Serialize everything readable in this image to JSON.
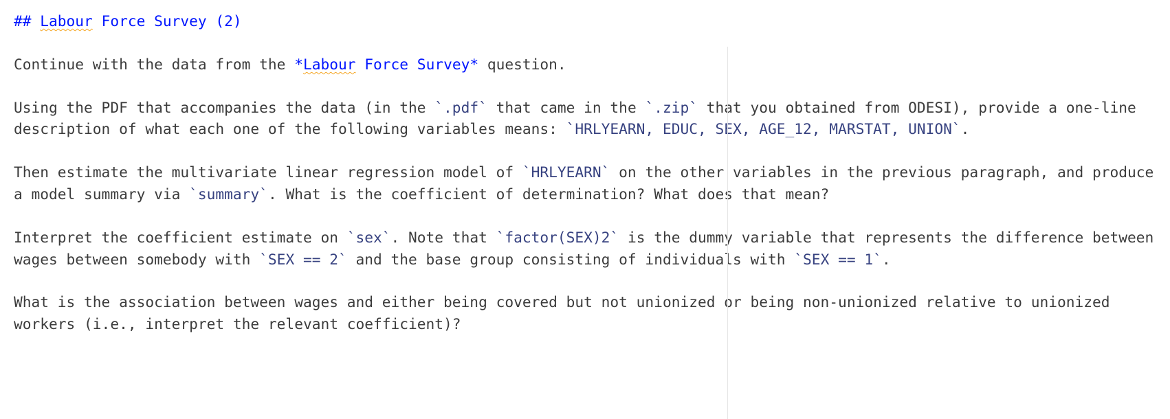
{
  "heading": {
    "prefix": "## ",
    "text": "Labour",
    "rest": " Force Survey (2)"
  },
  "p1": {
    "a": "Continue with the data from the ",
    "link_star1": "*",
    "link_word": "Labour",
    "link_rest": " Force Survey*",
    "b": " question."
  },
  "p2": {
    "a": "Using the PDF that accompanies the data (in the ",
    "c1": "`.pdf`",
    "b": " that came in the ",
    "c2": "`.zip`",
    "c": " that you obtained from ODESI), provide a one-line description of what each one of the following variables means: ",
    "c3": "`HRLYEARN, EDUC, SEX, AGE_12, MARSTAT, UNION`",
    "d": "."
  },
  "p3": {
    "a": "Then estimate the multivariate linear regression model of ",
    "c1": "`HRLYEARN`",
    "b": " on the other variables in the previous paragraph, and produce a model summary via ",
    "c2": "`summary`",
    "c": ". What is the coefficient of determination? What does that mean?"
  },
  "p4": {
    "a": "Interpret the coefficient estimate on ",
    "c1": "`sex`",
    "b": ". Note that ",
    "c2": "`factor(SEX)2`",
    "c": " is the dummy variable that represents the difference between wages between somebody with ",
    "c3": "`SEX == 2`",
    "d": " and the base group consisting of individuals with ",
    "c4": "`SEX == 1`",
    "e": "."
  },
  "p5": {
    "a": "What is the association between wages and either being covered but not unionized or being non-unionized relative to unionized workers (i.e., interpret the relevant coefficient)?"
  }
}
